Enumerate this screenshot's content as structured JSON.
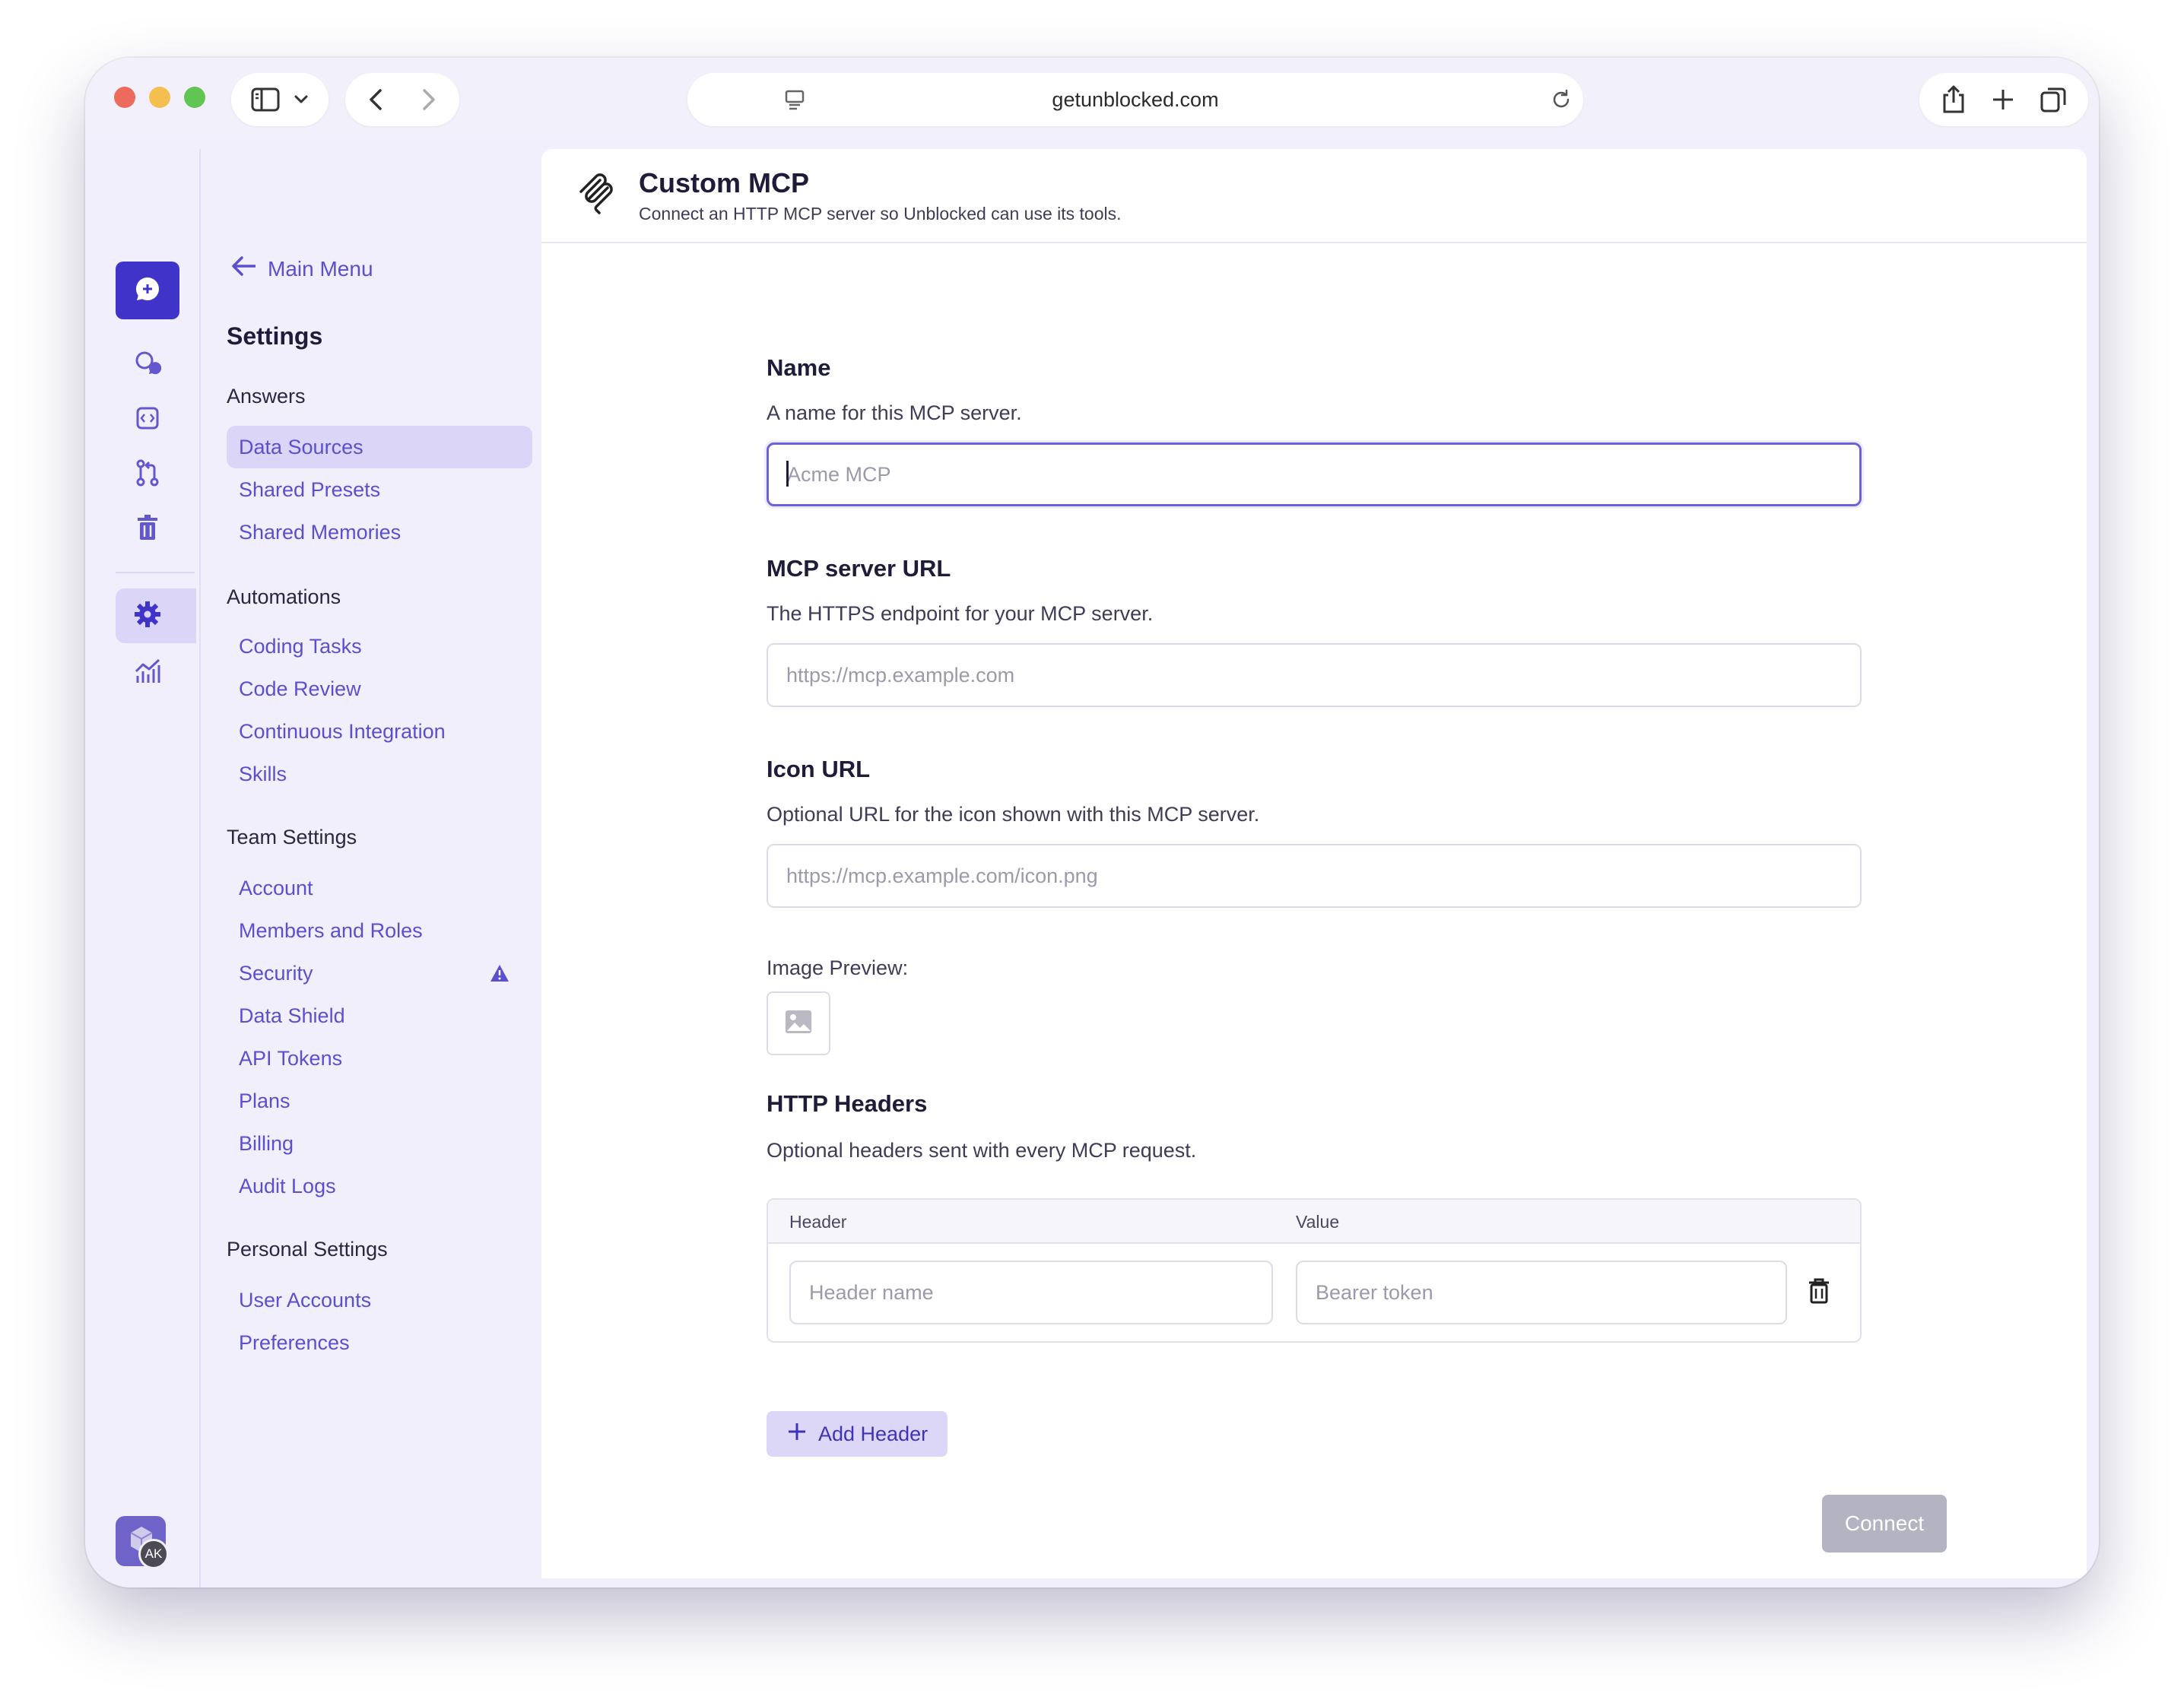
{
  "browser": {
    "url": "getunblocked.com"
  },
  "sidebar": {
    "back_label": "Main Menu",
    "title": "Settings",
    "groups": [
      {
        "label": "Answers",
        "items": [
          "Data Sources",
          "Shared Presets",
          "Shared Memories"
        ]
      },
      {
        "label": "Automations",
        "items": [
          "Coding Tasks",
          "Code Review",
          "Continuous Integration",
          "Skills"
        ]
      },
      {
        "label": "Team Settings",
        "items": [
          "Account",
          "Members and Roles",
          "Security",
          "Data Shield",
          "API Tokens",
          "Plans",
          "Billing",
          "Audit Logs"
        ]
      },
      {
        "label": "Personal Settings",
        "items": [
          "User Accounts",
          "Preferences"
        ]
      }
    ],
    "active_item": "Data Sources",
    "warning_item": "Security"
  },
  "header": {
    "title": "Custom MCP",
    "subtitle": "Connect an HTTP MCP server so Unblocked can use its tools."
  },
  "form": {
    "name": {
      "label": "Name",
      "help": "A name for this MCP server.",
      "placeholder": "Acme MCP",
      "value": ""
    },
    "url": {
      "label": "MCP server URL",
      "help": "The HTTPS endpoint for your MCP server.",
      "placeholder": "https://mcp.example.com",
      "value": ""
    },
    "icon": {
      "label": "Icon URL",
      "help": "Optional URL for the icon shown with this MCP server.",
      "placeholder": "https://mcp.example.com/icon.png",
      "value": ""
    },
    "preview_label": "Image Preview:",
    "headers": {
      "label": "HTTP Headers",
      "help": "Optional headers sent with every MCP request.",
      "col_header": "Header",
      "col_value": "Value",
      "header_placeholder": "Header name",
      "value_placeholder": "Bearer token",
      "add_label": "Add Header"
    },
    "connect_label": "Connect"
  },
  "user": {
    "initials": "AK"
  },
  "colors": {
    "accent": "#5b4fcf",
    "rail_active": "#3f33c9",
    "sidebar_bg": "#f1effb"
  }
}
